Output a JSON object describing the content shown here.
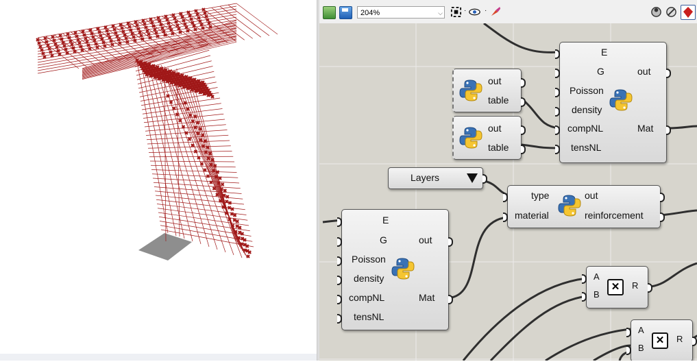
{
  "toolbar": {
    "zoom_value": "204%",
    "icons": [
      "open-file-icon",
      "save-icon",
      "zoom-extents-icon",
      "preview-eye-icon",
      "sketch-pen-icon",
      "sphere-display-icon",
      "no-preview-icon",
      "render-preview-icon"
    ]
  },
  "viewport": {
    "model": "red-wireframe-t-structure",
    "colors": {
      "wire": "#a01818",
      "shadow": "#8e8e8e"
    }
  },
  "canvas": {
    "background": "#d7d5cd",
    "components": {
      "material_top": {
        "inputs": [
          "E",
          "G",
          "Poisson",
          "density",
          "compNL",
          "tensNL"
        ],
        "outputs": [
          "out",
          "Mat"
        ]
      },
      "python_a": {
        "outputs": [
          "out",
          "table"
        ]
      },
      "python_b": {
        "outputs": [
          "out",
          "table"
        ]
      },
      "layers_picker": {
        "label": "Layers"
      },
      "reinforcement": {
        "inputs": [
          "type",
          "material"
        ],
        "outputs": [
          "out",
          "reinforcement"
        ]
      },
      "material_bottom": {
        "inputs": [
          "E",
          "G",
          "Poisson",
          "density",
          "compNL",
          "tensNL"
        ],
        "outputs": [
          "out",
          "Mat"
        ]
      },
      "multiply_a": {
        "inputs": [
          "A",
          "B"
        ],
        "output": "R"
      },
      "multiply_b": {
        "inputs": [
          "A",
          "B"
        ],
        "output": "R"
      }
    }
  }
}
